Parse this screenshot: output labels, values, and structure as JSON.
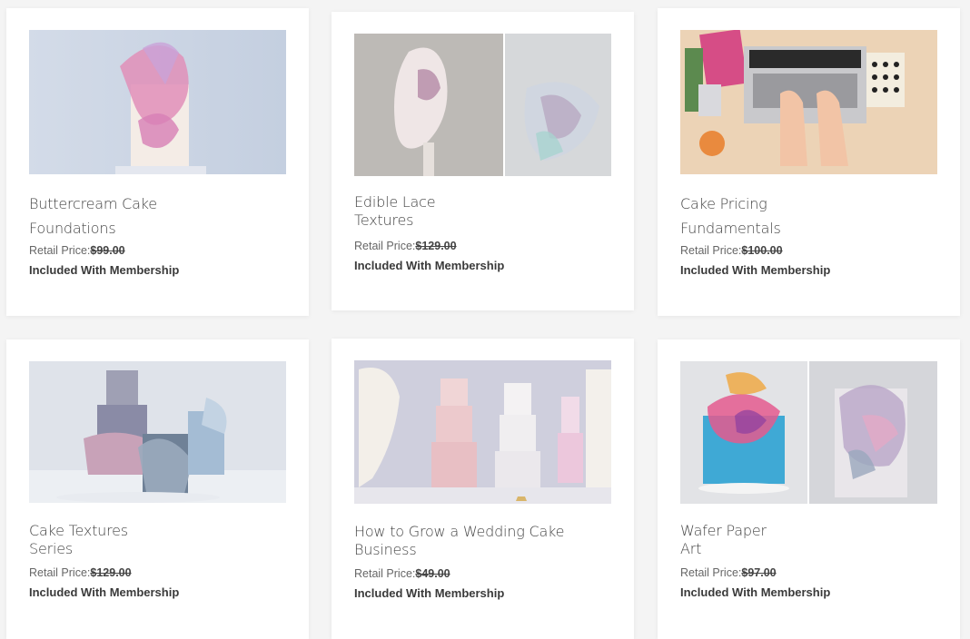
{
  "courses": [
    {
      "title_lines": [
        "Buttercream Cake",
        "Foundations"
      ],
      "retail_label": "Retail Price:",
      "price": "$99.00",
      "membership": "Included With Membership",
      "image_alt": "buttercream-cake-image"
    },
    {
      "title_lines": [
        "Edible Lace",
        "Textures"
      ],
      "retail_label": "Retail Price:",
      "price": "$129.00",
      "membership": "Included With Membership",
      "image_alt": "edible-lace-image"
    },
    {
      "title_lines": [
        "Cake Pricing",
        "Fundamentals"
      ],
      "retail_label": "Retail Price:",
      "price": "$100.00",
      "membership": "Included With Membership",
      "image_alt": "laptop-typing-image"
    },
    {
      "title_lines": [
        "Cake Textures",
        "Series"
      ],
      "retail_label": "Retail Price:",
      "price": "$129.00",
      "membership": "Included With Membership",
      "image_alt": "cake-textures-image"
    },
    {
      "title_lines": [
        "How to Grow a Wedding Cake",
        "Business"
      ],
      "retail_label": "Retail Price:",
      "price": "$49.00",
      "membership": "Included With Membership",
      "image_alt": "wedding-cakes-display-image"
    },
    {
      "title_lines": [
        "Wafer Paper",
        "Art"
      ],
      "retail_label": "Retail Price:",
      "price": "$97.00",
      "membership": "Included With Membership",
      "image_alt": "wafer-paper-cake-image"
    }
  ]
}
